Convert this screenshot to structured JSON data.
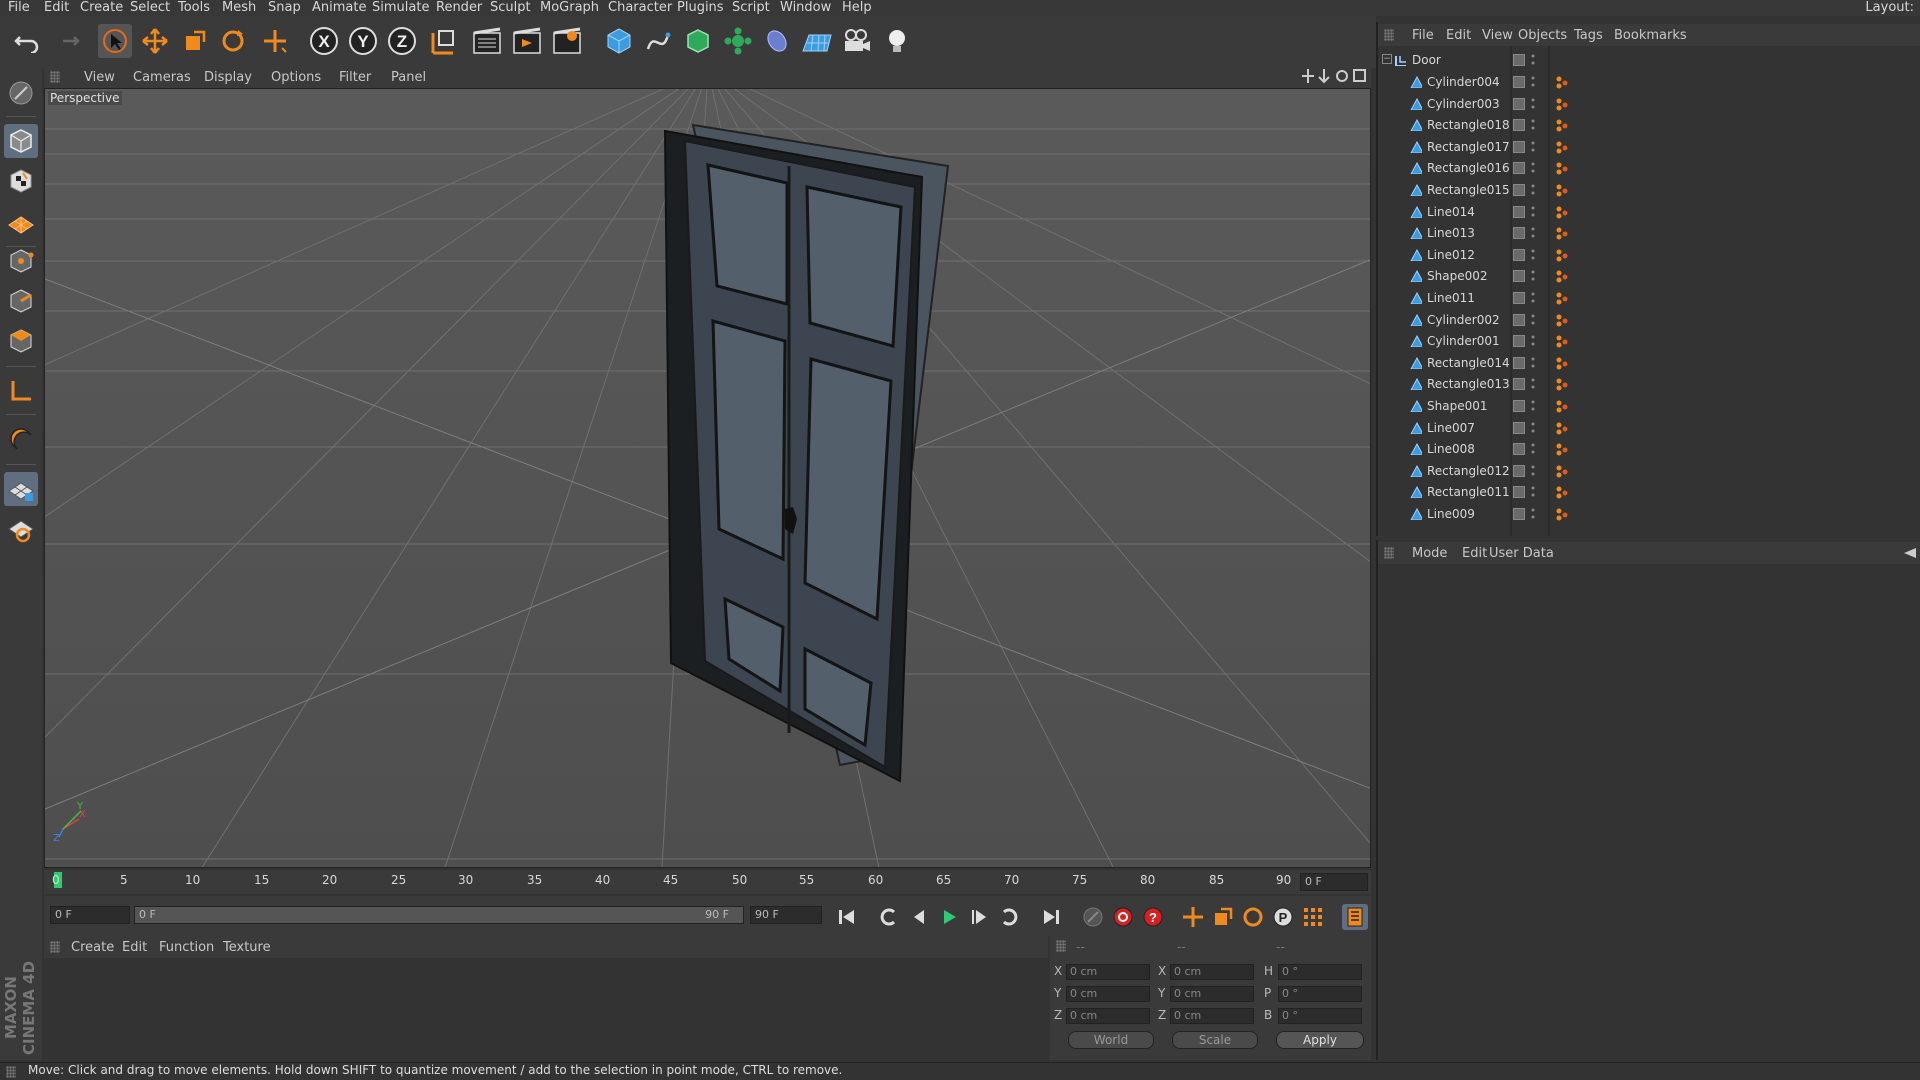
{
  "menubar": {
    "items": [
      "File",
      "Edit",
      "Create",
      "Select",
      "Tools",
      "Mesh",
      "Snap",
      "Animate",
      "Simulate",
      "Render",
      "Sculpt",
      "MoGraph",
      "Character",
      "Plugins",
      "Script",
      "Window",
      "Help"
    ],
    "layout_label": "Layout:"
  },
  "toolbar": {
    "icons": [
      "undo-icon",
      "redo-icon",
      "select-arrow-icon",
      "move-icon",
      "scale-icon",
      "rotate-icon",
      "live-selection-icon",
      "x-axis-icon",
      "y-axis-icon",
      "z-axis-icon",
      "coordinate-system-icon",
      "render-view-icon",
      "render-picture-viewer-icon",
      "edit-render-settings-icon",
      "cube-icon",
      "spline-pen-icon",
      "subdivision-icon",
      "array-icon",
      "deformer-icon",
      "floor-icon",
      "camera-icon",
      "light-icon"
    ],
    "axis_labels": {
      "x": "X",
      "y": "Y",
      "z": "Z"
    }
  },
  "viewport": {
    "menu": [
      "View",
      "Cameras",
      "Display",
      "Options",
      "Filter",
      "Panel"
    ],
    "label": "Perspective",
    "axis": {
      "x": "X",
      "y": "Y",
      "z": "Z"
    }
  },
  "timeline": {
    "ticks": [
      "0",
      "5",
      "10",
      "15",
      "20",
      "25",
      "30",
      "35",
      "40",
      "45",
      "50",
      "55",
      "60",
      "65",
      "70",
      "75",
      "80",
      "85",
      "90"
    ],
    "current_frame": "0 F",
    "start_field": "0 F",
    "range_start": "0 F",
    "range_end": "90 F",
    "end_field": "90 F"
  },
  "material_manager": {
    "menu": [
      "Create",
      "Edit",
      "Function",
      "Texture"
    ]
  },
  "coordinates": {
    "headers": [
      "--",
      "--",
      "--"
    ],
    "rows": [
      {
        "axis": "X",
        "pos": "0 cm",
        "size_axis": "X",
        "size": "0 cm",
        "rot_axis": "H",
        "rot": "0 °"
      },
      {
        "axis": "Y",
        "pos": "0 cm",
        "size_axis": "Y",
        "size": "0 cm",
        "rot_axis": "P",
        "rot": "0 °"
      },
      {
        "axis": "Z",
        "pos": "0 cm",
        "size_axis": "Z",
        "size": "0 cm",
        "rot_axis": "B",
        "rot": "0 °"
      }
    ],
    "world": "World",
    "scale": "Scale",
    "apply": "Apply"
  },
  "object_manager": {
    "menu": [
      "File",
      "Edit",
      "View",
      "Objects",
      "Tags",
      "Bookmarks"
    ],
    "root": "Door",
    "objects": [
      "Cylinder004",
      "Cylinder003",
      "Rectangle018",
      "Rectangle017",
      "Rectangle016",
      "Rectangle015",
      "Line014",
      "Line013",
      "Line012",
      "Shape002",
      "Line011",
      "Cylinder002",
      "Cylinder001",
      "Rectangle014",
      "Rectangle013",
      "Shape001",
      "Line007",
      "Line008",
      "Rectangle012",
      "Rectangle011",
      "Line009"
    ]
  },
  "attribute_manager": {
    "menu": [
      "Mode",
      "Edit",
      "User Data"
    ]
  },
  "status": {
    "text": "Move: Click and drag to move elements. Hold down SHIFT to quantize movement / add to the selection in point mode, CTRL to remove."
  },
  "brand": {
    "text": "MAXON CINEMA 4D"
  },
  "colors": {
    "accent": "#f08a1c",
    "selection": "#5f6f80",
    "timeline_marker": "#2ecc71"
  }
}
